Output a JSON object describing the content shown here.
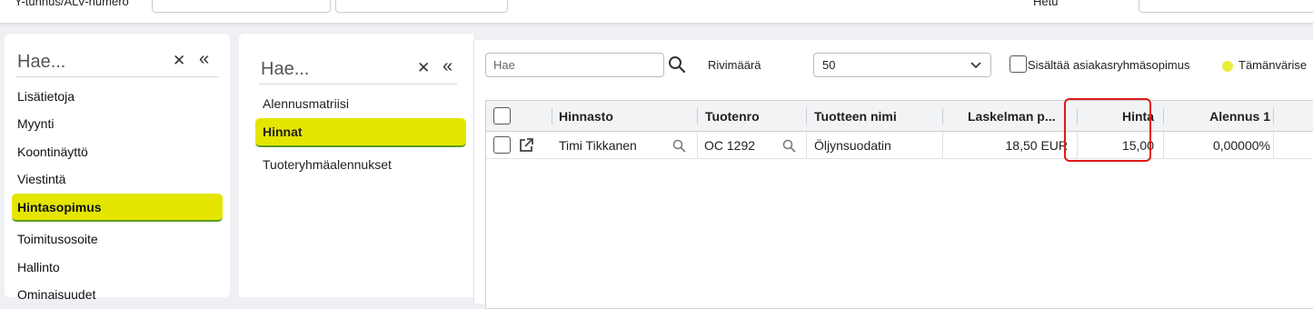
{
  "top": {
    "field1_label": "Y-tunnus/ALV-numero",
    "field2_label": "Hetu"
  },
  "left_panel": {
    "search_placeholder": "Hae...",
    "items": [
      {
        "label": "Lisätietoja"
      },
      {
        "label": "Myynti"
      },
      {
        "label": "Koontinäyttö"
      },
      {
        "label": "Viestintä"
      },
      {
        "label": "Hintasopimus",
        "active": true
      },
      {
        "label": "Toimitusosoite"
      },
      {
        "label": "Hallinto"
      },
      {
        "label": "Ominaisuudet"
      }
    ]
  },
  "mid_panel": {
    "search_placeholder": "Hae...",
    "items": [
      {
        "label": "Alennusmatriisi"
      },
      {
        "label": "Hinnat",
        "active": true
      },
      {
        "label": "Tuoteryhmäalennukset"
      }
    ]
  },
  "toolbar": {
    "search_placeholder": "Hae",
    "rows_label": "Rivimäärä",
    "rows_value": "50",
    "checkbox_label": "Sisältää asiakasryhmäsopimus",
    "legend_label": "Tämänvärise",
    "legend_color": "#e8ef3a"
  },
  "table": {
    "columns": [
      "Hinnasto",
      "Tuotenro",
      "Tuotteen nimi",
      "Laskelman p...",
      "Hinta",
      "Alennus 1"
    ],
    "rows": [
      {
        "hinnasto": "Timi Tikkanen",
        "tuotenro": "OC 1292",
        "nimi": "Öljynsuodatin",
        "laskelman": "18,50 EUR",
        "hinta": "15,00",
        "alennus": "0,00000%"
      }
    ]
  },
  "colors": {
    "active_bg": "#e4e600",
    "active_underline": "#5a9c1f",
    "highlight": "#e01a1a"
  }
}
